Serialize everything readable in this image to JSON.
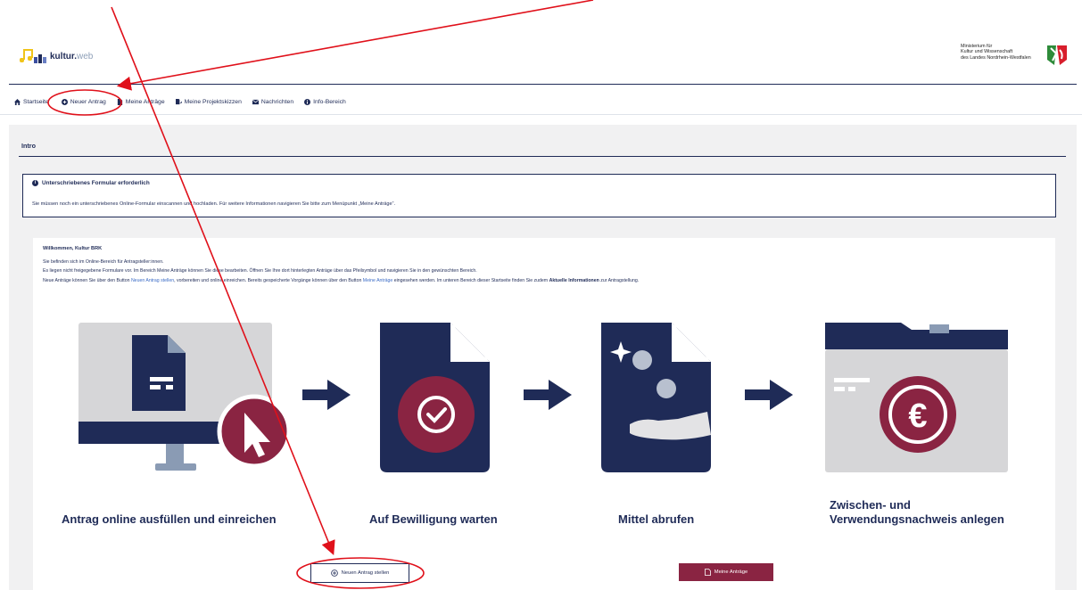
{
  "header": {
    "logo_bold": "kultur.",
    "logo_light": "web",
    "ministry_lines": [
      "Ministerium für",
      "Kultur und Wissenschaft",
      "des Landes Nordrhein-Westfalen"
    ]
  },
  "nav": {
    "items": [
      {
        "label": "Startseite",
        "icon": "home-icon"
      },
      {
        "label": "Neuer Antrag",
        "icon": "plus-circle-icon"
      },
      {
        "label": "Meine Anträge",
        "icon": "document-icon"
      },
      {
        "label": "Meine Projektskizzen",
        "icon": "sketch-icon"
      },
      {
        "label": "Nachrichten",
        "icon": "envelope-icon"
      },
      {
        "label": "Info-Bereich",
        "icon": "info-icon"
      }
    ]
  },
  "intro": {
    "title": "Intro",
    "alert_title": "Unterschriebenes Formular erforderlich",
    "alert_text": "Sie müssen noch ein unterschriebenes Online-Formular einscannen und hochladen. Für weitere Informationen navigieren Sie bitte zum Menüpunkt „Meine Anträge“."
  },
  "welcome": {
    "title": "Willkommen, Kultur BRK",
    "line1": "Sie befinden sich im Online-Bereich für Antragsteller:innen.",
    "line2": "Es liegen nicht freigegebene Formulare vor. Im Bereich Meine Anträge können Sie diese bearbeiten. Öffnen Sie Ihre dort hinterlegten Anträge über das Pfeilsymbol und navigieren Sie in den gewünschten Bereich.",
    "line3_a": "Neue Anträge können Sie über den Button ",
    "line3_link1": "Neuen Antrag stellen",
    "line3_b": ", vorbereiten und online einreichen. Bereits gespeicherte Vorgänge können über den Button ",
    "line3_link2": "Meine Anträge",
    "line3_c": " eingesehen werden. Im unteren Bereich dieser Startseite finden Sie zudem ",
    "line3_bold": "Aktuelle Informationen",
    "line3_d": " zur Antragstellung."
  },
  "steps": [
    {
      "label": "Antrag online ausfüllen und einreichen"
    },
    {
      "label": "Auf Bewilligung warten"
    },
    {
      "label": "Mittel abrufen"
    },
    {
      "label_line1": "Zwischen- und",
      "label_line2": "Verwendungsnachweis anlegen"
    }
  ],
  "buttons": {
    "new_application": "Neuen Antrag stellen",
    "my_applications": "Meine Anträge"
  },
  "colors": {
    "navy": "#1f2b57",
    "burgundy": "#8a2442",
    "annotation_red": "#e0101a"
  }
}
